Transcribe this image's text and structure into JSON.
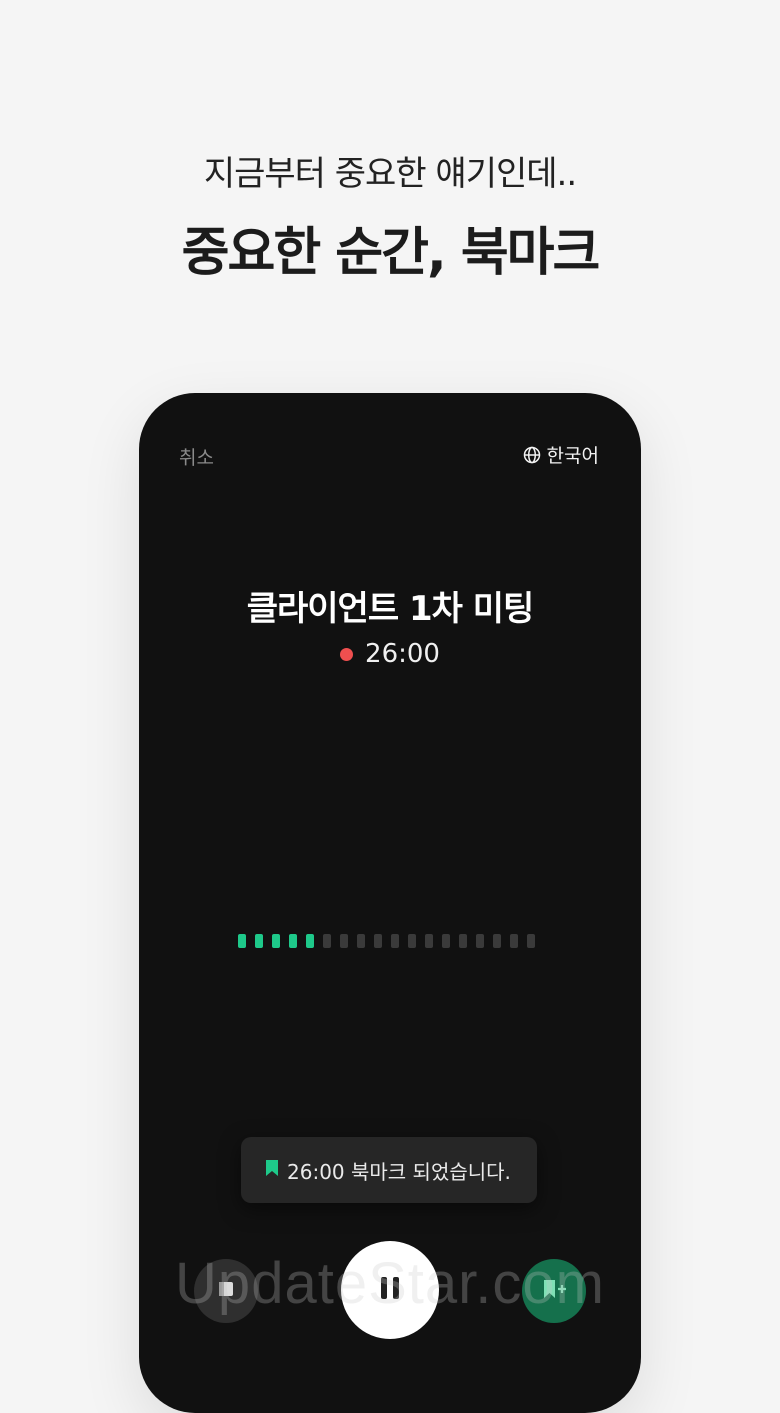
{
  "promo": {
    "subtitle": "지금부터 중요한 얘기인데..",
    "headline": "중요한 순간, 북마크"
  },
  "screen": {
    "cancel_label": "취소",
    "language_label": "한국어",
    "meeting_title": "클라이언트 1차 미팅",
    "elapsed_time": "26:00",
    "level_meter": {
      "active_bars": 5,
      "total_bars": 18
    },
    "toast_message": "26:00 북마크 되었습니다."
  },
  "colors": {
    "accent": "#1ec98a",
    "record": "#ef4f4f",
    "phone_bg": "#111111",
    "page_bg": "#f5f5f5"
  },
  "icons": {
    "language": "globe-icon",
    "toast": "bookmark-icon",
    "left_control": "note-icon",
    "main_control": "pause-icon",
    "right_control": "bookmark-add-icon"
  },
  "watermark": "UpdateStar.com"
}
